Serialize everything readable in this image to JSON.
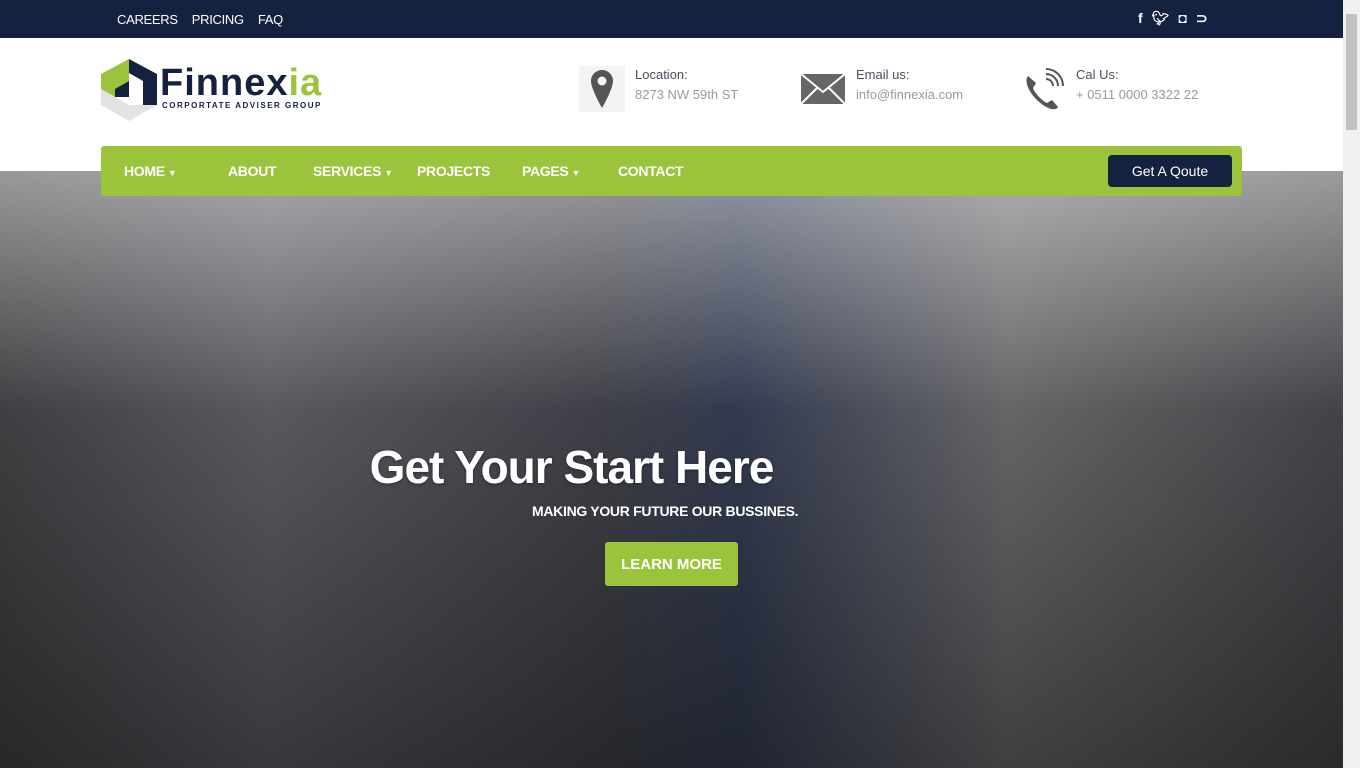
{
  "topbar": {
    "links": [
      "CAREERS",
      "PRICING",
      "FAQ"
    ],
    "social": [
      "facebook-icon",
      "twitter-icon",
      "instagram-icon",
      "rss-icon"
    ]
  },
  "brand": {
    "name_main": "Finnex",
    "name_accent": "ia",
    "tagline": "CORPORTATE ADVISER GROUP",
    "accent": "#9bc43c",
    "dark": "#14213f"
  },
  "contact": [
    {
      "label": "Location:",
      "value": "8273 NW 59th ST",
      "icon": "map-pin-icon"
    },
    {
      "label": "Email us:",
      "value": "info@finnexia.com",
      "icon": "envelope-icon"
    },
    {
      "label": "Cal Us:",
      "value": "+ 0511 0000 3322 22",
      "icon": "phone-icon"
    }
  ],
  "nav": {
    "items": [
      "HOME",
      "ABOUT",
      "SERVICES",
      "PROJECTS",
      "PAGES",
      "CONTACT"
    ],
    "cta": "Get A Qoute"
  },
  "hero": {
    "title": "Get Your Start Here",
    "subtitle": "MAKING YOUR FUTURE OUR BUSSINES.",
    "button": "LEARN MORE"
  }
}
